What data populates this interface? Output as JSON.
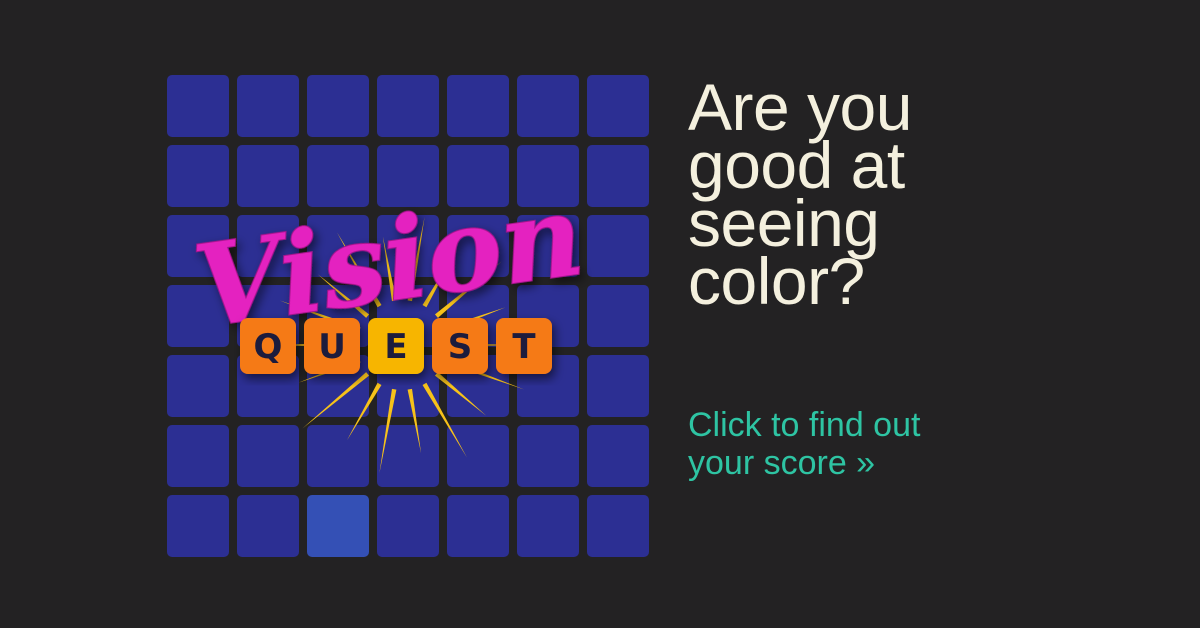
{
  "headline": {
    "lines": [
      "Are you",
      "good at",
      "seeing",
      "color?"
    ]
  },
  "cta": {
    "lines": [
      "Click to find out",
      "your score »"
    ]
  },
  "logo": {
    "script_word": "Vision",
    "block_letters": [
      "Q",
      "U",
      "E",
      "S",
      "T"
    ]
  },
  "grid": {
    "rows": 7,
    "columns": 7,
    "base_color": "#2c2f93",
    "odd_tile": {
      "row": 6,
      "column": 2,
      "color": "#3450b5"
    }
  },
  "colors": {
    "background": "#232223",
    "headline": "#f4f0de",
    "cta": "#2ec4a3",
    "vision_magenta": "#e423c0",
    "quest_orange": "#f57a14",
    "quest_yellow": "#f7b500",
    "sunburst": "#f7c21a"
  }
}
